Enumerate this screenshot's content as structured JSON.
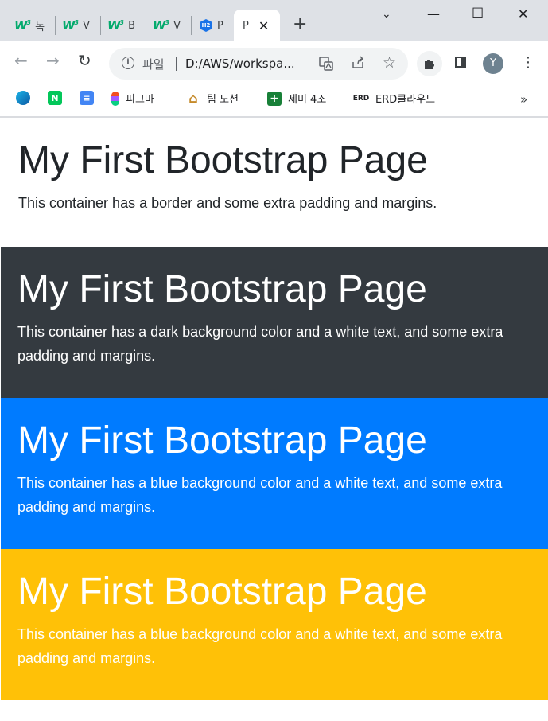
{
  "browser": {
    "tabs": [
      {
        "icon": "w3",
        "label": "녹"
      },
      {
        "icon": "w3",
        "label": "V"
      },
      {
        "icon": "w3",
        "label": "B"
      },
      {
        "icon": "w3",
        "label": "V"
      },
      {
        "icon": "hex",
        "label": "P"
      },
      {
        "icon": "",
        "label": "P",
        "active": true
      }
    ],
    "active_tab_close": "✕",
    "new_tab": "+",
    "window_controls": {
      "dropdown": "⌄",
      "minimize": "—",
      "maximize": "☐",
      "close": "✕"
    },
    "nav": {
      "back": "←",
      "forward": "→",
      "reload": "↻"
    },
    "address": {
      "scheme_label": "파일",
      "url": "D:/AWS/workspa..."
    },
    "profile_initial": "Y",
    "bookmarks": [
      {
        "icon": "edge-icon",
        "label": ""
      },
      {
        "icon": "naver-icon",
        "label": ""
      },
      {
        "icon": "docs-icon",
        "label": ""
      },
      {
        "icon": "figma-icon",
        "label": "피그마"
      },
      {
        "icon": "house-icon",
        "label": "팀 노션"
      },
      {
        "icon": "sheets-icon",
        "label": "세미 4조"
      },
      {
        "icon": "erd-icon",
        "label": "ERD클라우드"
      }
    ],
    "bookmarks_more": "»"
  },
  "page": {
    "sections": [
      {
        "heading": "My First Bootstrap Page",
        "text": "This container has a border and some extra padding and margins."
      },
      {
        "heading": "My First Bootstrap Page",
        "text": "This container has a dark background color and a white text, and some extra padding and margins."
      },
      {
        "heading": "My First Bootstrap Page",
        "text": "This container has a blue background color and a white text, and some extra padding and margins."
      },
      {
        "heading": "My First Bootstrap Page",
        "text": "This container has a blue background color and a white text, and some extra padding and margins."
      }
    ]
  },
  "colors": {
    "dark": "#343a40",
    "primary": "#007bff",
    "warning": "#ffc107",
    "chrome": "#dee1e6"
  }
}
